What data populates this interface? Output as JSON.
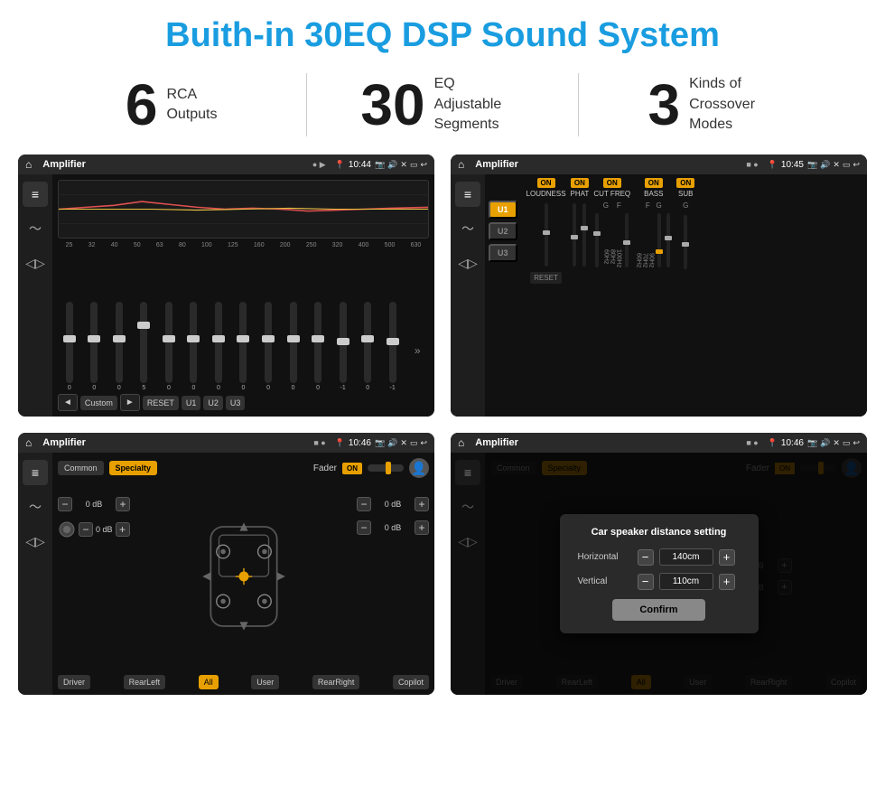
{
  "page": {
    "title": "Buith-in 30EQ DSP Sound System"
  },
  "stats": [
    {
      "number": "6",
      "text": "RCA\nOutputs"
    },
    {
      "number": "30",
      "text": "EQ Adjustable\nSegments"
    },
    {
      "number": "3",
      "text": "Kinds of\nCrossover Modes"
    }
  ],
  "screens": [
    {
      "id": "screen1",
      "statusBar": {
        "title": "Amplifier",
        "time": "10:44"
      },
      "type": "eq"
    },
    {
      "id": "screen2",
      "statusBar": {
        "title": "Amplifier",
        "time": "10:45"
      },
      "type": "channels"
    },
    {
      "id": "screen3",
      "statusBar": {
        "title": "Amplifier",
        "time": "10:46"
      },
      "type": "fader"
    },
    {
      "id": "screen4",
      "statusBar": {
        "title": "Amplifier",
        "time": "10:46"
      },
      "type": "dialog",
      "dialog": {
        "title": "Car speaker distance setting",
        "horizontal": "140cm",
        "vertical": "110cm",
        "confirm": "Confirm"
      }
    }
  ],
  "eq": {
    "freqs": [
      "25",
      "32",
      "40",
      "50",
      "63",
      "80",
      "100",
      "125",
      "160",
      "200",
      "250",
      "320",
      "400",
      "500",
      "630"
    ],
    "values": [
      "0",
      "0",
      "0",
      "5",
      "0",
      "0",
      "0",
      "0",
      "0",
      "0",
      "0",
      "-1",
      "0",
      "-1"
    ],
    "presets": [
      "Custom",
      "RESET",
      "U1",
      "U2",
      "U3"
    ]
  },
  "channels": {
    "presets": [
      "U1",
      "U2",
      "U3"
    ],
    "labels": [
      "LOUDNESS",
      "PHAT",
      "CUT FREQ",
      "BASS",
      "SUB"
    ],
    "on": [
      "ON",
      "ON",
      "ON",
      "ON",
      "ON"
    ],
    "reset": "RESET"
  },
  "fader": {
    "tabs": [
      "Common",
      "Specialty"
    ],
    "activeTab": "Specialty",
    "faderLabel": "Fader",
    "onToggle": "ON",
    "leftValues": [
      "0 dB",
      "0 dB"
    ],
    "rightValues": [
      "0 dB",
      "0 dB"
    ],
    "buttons": {
      "driver": "Driver",
      "rearLeft": "RearLeft",
      "all": "All",
      "user": "User",
      "rearRight": "RearRight",
      "copilot": "Copilot"
    }
  },
  "dialog": {
    "title": "Car speaker distance setting",
    "horizontal_label": "Horizontal",
    "horizontal_value": "140cm",
    "vertical_label": "Vertical",
    "vertical_value": "110cm",
    "confirm": "Confirm",
    "db_labels": [
      "0 dB",
      "0 dB"
    ]
  }
}
